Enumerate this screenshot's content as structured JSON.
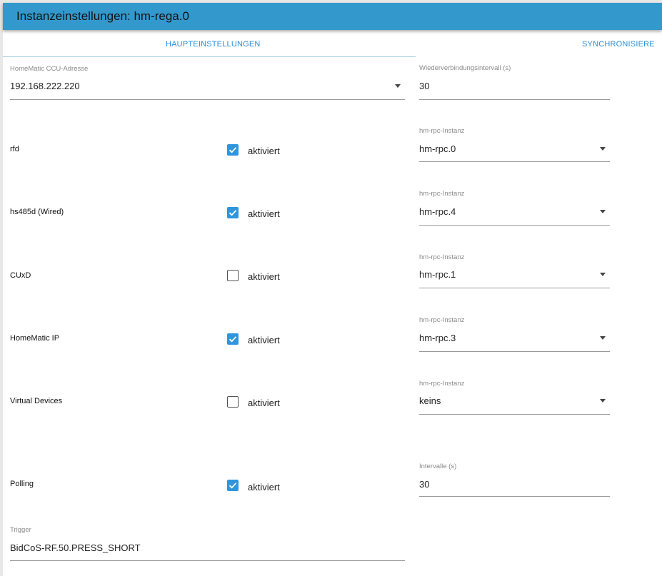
{
  "dialog": {
    "title": "Instanzeinstellungen: hm-rega.0"
  },
  "tabs": [
    {
      "label": "HAUPTEINSTELLUNGEN",
      "active": true
    },
    {
      "label": "SYNCHRONISIERE",
      "active": false
    }
  ],
  "ccu": {
    "label": "HomeMatic CCU-Adresse",
    "value": "192.168.222.220"
  },
  "reconnect": {
    "label": "Wiederverbindungsintervall (s)",
    "value": "30"
  },
  "rows": [
    {
      "name": "rfd",
      "checked": true,
      "check_label": "aktiviert",
      "select_label": "hm-rpc-Instanz",
      "select_value": "hm-rpc.0"
    },
    {
      "name": "hs485d (Wired)",
      "checked": true,
      "check_label": "aktiviert",
      "select_label": "hm-rpc-Instanz",
      "select_value": "hm-rpc.4"
    },
    {
      "name": "CUxD",
      "checked": false,
      "check_label": "aktiviert",
      "select_label": "hm-rpc-Instanz",
      "select_value": "hm-rpc.1"
    },
    {
      "name": "HomeMatic IP",
      "checked": true,
      "check_label": "aktiviert",
      "select_label": "hm-rpc-Instanz",
      "select_value": "hm-rpc.3"
    },
    {
      "name": "Virtual Devices",
      "checked": false,
      "check_label": "aktiviert",
      "select_label": "hm-rpc-Instanz",
      "select_value": "keins"
    }
  ],
  "polling": {
    "name": "Polling",
    "checked": true,
    "check_label": "aktiviert",
    "interval_label": "Intervalle (s)",
    "interval_value": "30"
  },
  "trigger": {
    "label": "Trigger",
    "value": "BidCoS-RF.50.PRESS_SHORT"
  },
  "colors": {
    "accent": "#3399cc",
    "checkbox": "#2f95dc",
    "tab_text": "#2a8fd6"
  }
}
